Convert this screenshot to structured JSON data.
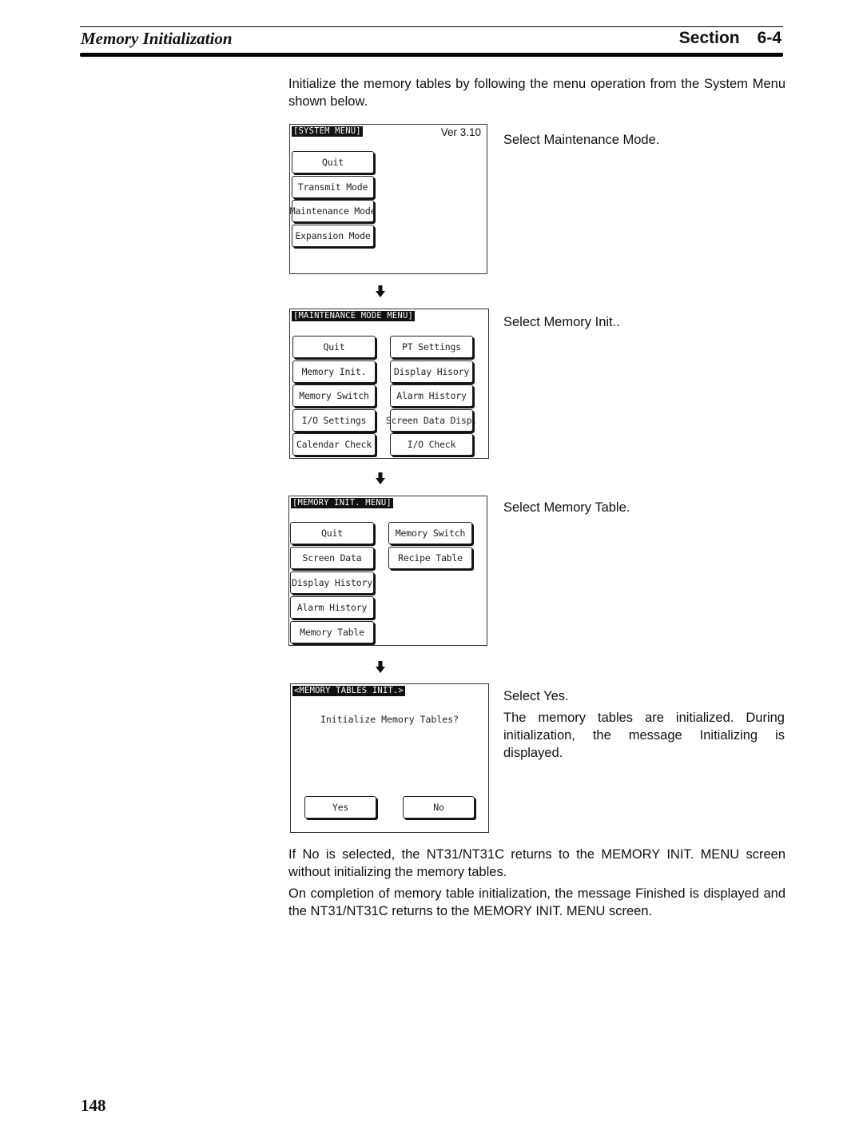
{
  "header": {
    "title": "Memory Initialization",
    "section_label": "Section",
    "section_number": "6-4"
  },
  "intro": "Initialize the memory tables by following the menu operation from the System Menu shown below.",
  "steps": [
    {
      "caption": "Select Maintenance Mode.",
      "screen": {
        "title": "[SYSTEM MENU]",
        "version": "Ver 3.10",
        "buttons": [
          "Quit",
          "Transmit Mode",
          "Maintenance Mode",
          "Expansion Mode"
        ]
      }
    },
    {
      "caption": "Select Memory Init..",
      "screen": {
        "title": "[MAINTENANCE MODE MENU]",
        "left_buttons": [
          "Quit",
          "Memory Init.",
          "Memory Switch",
          "I/O Settings",
          "Calendar Check"
        ],
        "right_buttons": [
          "PT Settings",
          "Display Hisory",
          "Alarm History",
          "Screen Data Disp.",
          "I/O Check"
        ]
      }
    },
    {
      "caption": "Select Memory Table.",
      "screen": {
        "title": "[MEMORY INIT. MENU]",
        "left_buttons": [
          "Quit",
          "Screen Data",
          "Display History",
          "Alarm History",
          "Memory Table"
        ],
        "right_buttons": [
          "Memory Switch",
          "Recipe Table"
        ]
      }
    },
    {
      "caption": "Select Yes.",
      "detail": "The memory tables are initialized. During initialization, the message Initializing is displayed.",
      "screen": {
        "title": "<MEMORY TABLES INIT.>",
        "prompt": "Initialize Memory Tables?",
        "yes_label": "Yes",
        "no_label": "No"
      }
    }
  ],
  "arrow_icon": "down-arrow-icon",
  "paragraph_no": "If No is selected, the NT31/NT31C returns to the MEMORY INIT. MENU screen without initializing the memory tables.",
  "paragraph_finish": "On completion of memory table initialization, the message Finished is displayed and the NT31/NT31C returns to the MEMORY INIT. MENU screen.",
  "page_number": "148"
}
